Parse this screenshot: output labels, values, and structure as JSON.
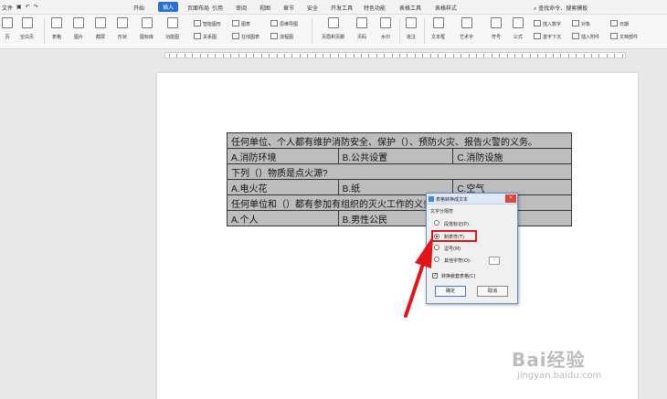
{
  "menubar": {
    "file": "文件",
    "tabs": [
      "开始",
      "插入",
      "页面布局",
      "引用",
      "审阅",
      "视图",
      "章节",
      "安全",
      "开发工具",
      "特色功能",
      "表格工具",
      "表格样式"
    ],
    "active_tab": "插入",
    "search": "查找命令、搜索模板"
  },
  "toolbar": {
    "big": [
      "页",
      "空白页",
      "表格",
      "图片",
      "截屏",
      "形状",
      "图标库",
      "功能图",
      "页眉和页脚",
      "页码",
      "水印",
      "批注",
      "文本框",
      "艺术字",
      "符号",
      "公式"
    ],
    "small": [
      "智能图形",
      "图表",
      "思维导图",
      "关系图",
      "在线图表",
      "流程图",
      "插入数字",
      "对象",
      "首字下沉",
      "插入附件",
      "日期",
      "文档部件"
    ]
  },
  "table": {
    "rows": [
      [
        "任何单位、个人都有维护消防安全、保护（）、预防火灾、报告火警的义务。"
      ],
      [
        "A.消防环境",
        "B.公共设置",
        "C.消防设施"
      ],
      [
        "下列（）物质是点火源?"
      ],
      [
        "A.电火花",
        "B.纸",
        "C.空气"
      ],
      [
        "任何单位和（）都有参加有组织的灭火工作的义务。"
      ],
      [
        "A.个人",
        "B.男性公民",
        ""
      ]
    ]
  },
  "dialog": {
    "title": "表格转换成文本",
    "group_label": "文字分隔符",
    "options": [
      "段落标记(P)",
      "制表符(T)",
      "逗号(M)",
      "其他字符(O):"
    ],
    "selected_index": 1,
    "other_value": "-",
    "checkbox_label": "转换嵌套表格(C)",
    "checkbox_checked": true,
    "ok": "确定",
    "cancel": "取消",
    "close": "×"
  },
  "watermark": {
    "logo": "Bai经验",
    "url": "jingyan.baidu.com"
  },
  "colors": {
    "accent": "#2a6fd6",
    "highlight": "#e0141a",
    "table_fill": "#bdbdbd"
  }
}
